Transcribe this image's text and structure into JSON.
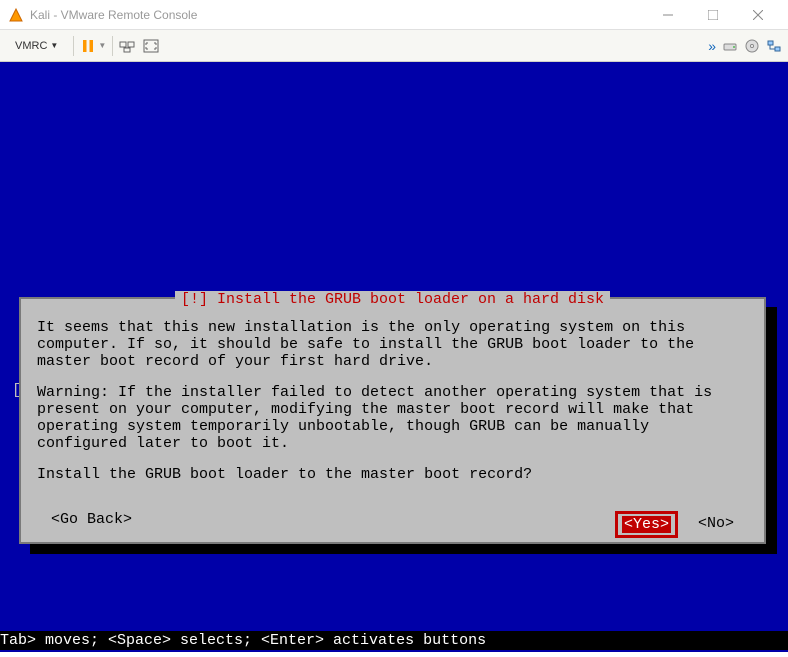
{
  "window": {
    "title": "Kali - VMware Remote Console"
  },
  "toolbar": {
    "vmrc_label": "VMRC"
  },
  "dialog": {
    "title": "[!] Install the GRUB boot loader on a hard disk",
    "para1": "It seems that this new installation is the only operating system on this computer. If so, it should be safe to install the GRUB boot loader to the master boot record of your first hard drive.",
    "para2": "Warning: If the installer failed to detect another operating system that is present on your computer, modifying the master boot record will make that operating system temporarily unbootable, though GRUB can be manually configured later to boot it.",
    "question": "Install the GRUB boot loader to the master boot record?",
    "go_back": "<Go Back>",
    "yes": "<Yes>",
    "no": "<No>"
  },
  "statusbar": {
    "text": "Tab> moves; <Space> selects; <Enter> activates buttons"
  }
}
